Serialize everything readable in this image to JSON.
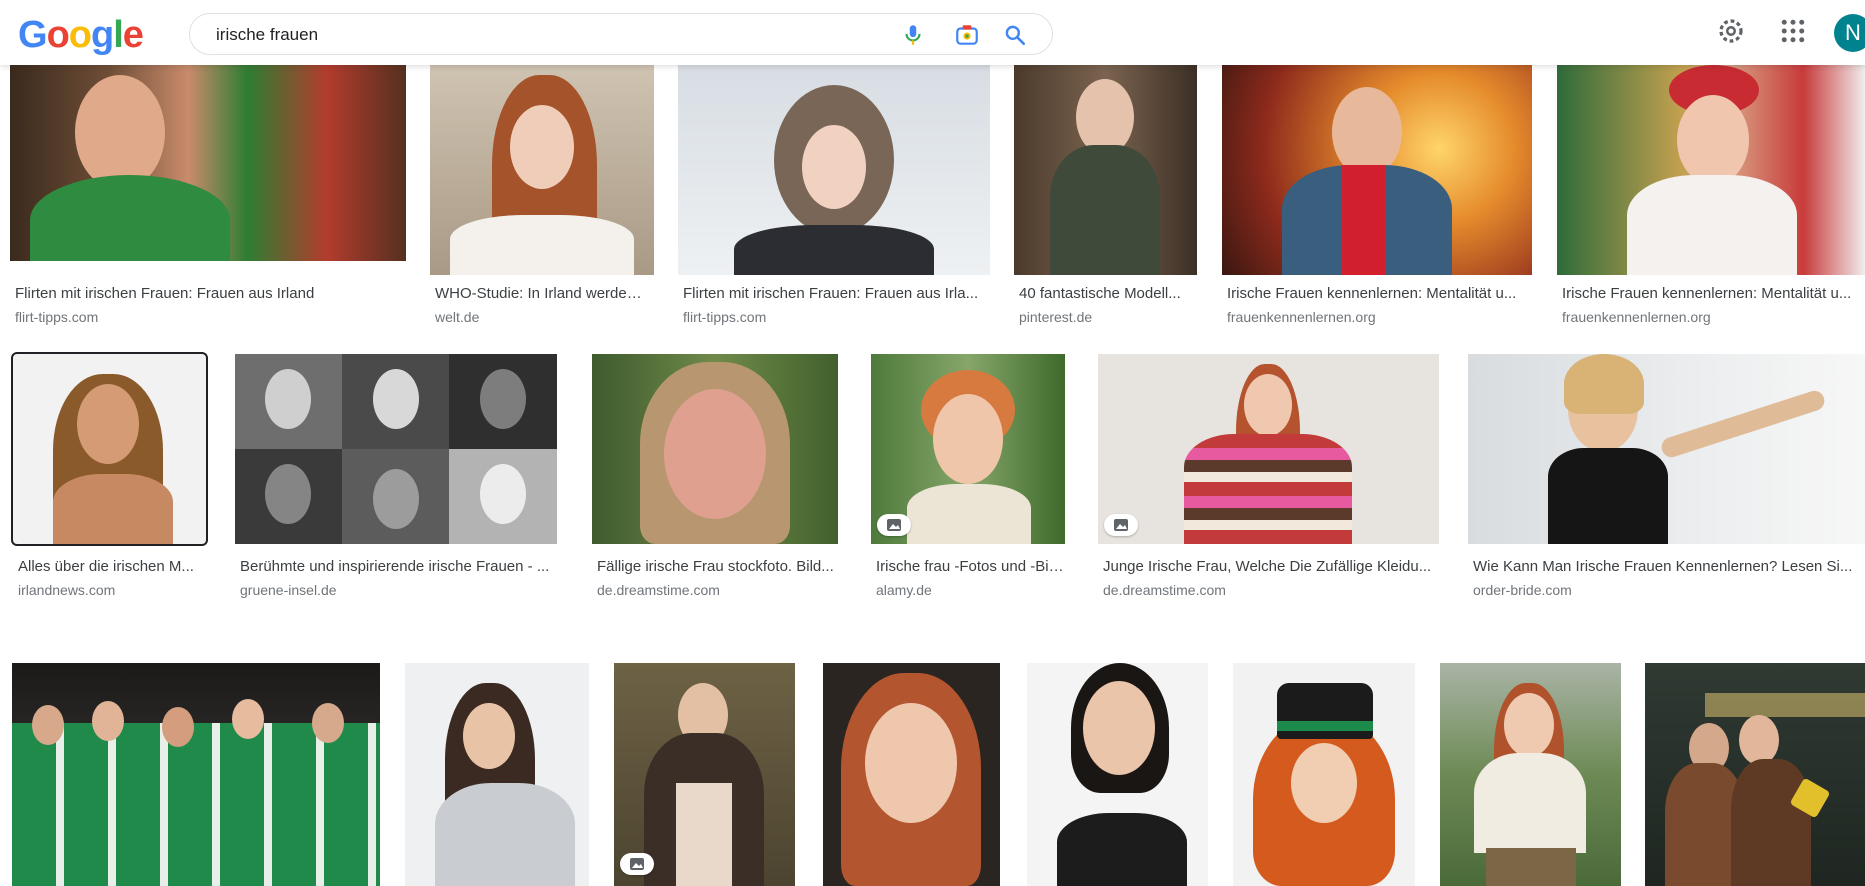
{
  "header": {
    "logo_letters": [
      "G",
      "o",
      "o",
      "g",
      "l",
      "e"
    ],
    "search_value": "irische frauen",
    "avatar_letter": "N"
  },
  "colors": {
    "brand_blue": "#4285f4",
    "brand_red": "#ea4335",
    "brand_yellow": "#fbbc05",
    "brand_green": "#34a853",
    "avatar_bg": "#00838f"
  },
  "results": {
    "row1": [
      {
        "title": "Flirten mit irischen Frauen: Frauen aus Irland",
        "source": "flirt-tipps.com"
      },
      {
        "title": "WHO-Studie: In Irland werden ...",
        "source": "welt.de"
      },
      {
        "title": "Flirten mit irischen Frauen: Frauen aus Irla...",
        "source": "flirt-tipps.com"
      },
      {
        "title": "40 fantastische Modell...",
        "source": "pinterest.de"
      },
      {
        "title": "Irische Frauen kennenlernen: Mentalität u...",
        "source": "frauenkennenlernen.org"
      },
      {
        "title": "Irische Frauen kennenlernen: Mentalität u...",
        "source": "frauenkennenlernen.org"
      }
    ],
    "row2": [
      {
        "title": "Alles über die irischen M...",
        "source": "irlandnews.com"
      },
      {
        "title": "Berühmte und inspirierende irische Frauen - ...",
        "source": "gruene-insel.de"
      },
      {
        "title": "Fällige irische Frau stockfoto. Bild...",
        "source": "de.dreamstime.com"
      },
      {
        "title": "Irische frau -Fotos und -Bil...",
        "source": "alamy.de"
      },
      {
        "title": "Junge Irische Frau, Welche Die Zufällige Kleidu...",
        "source": "de.dreamstime.com"
      },
      {
        "title": "Wie Kann Man Irische Frauen Kennenlernen? Lesen Si...",
        "source": "order-bride.com"
      }
    ],
    "row3_count_note": "8 thumbnails without visible captions"
  },
  "icons": {
    "mic": "microphone-icon",
    "lens": "camera-search-icon",
    "search": "search-icon",
    "settings": "gear-icon",
    "apps": "apps-grid-icon",
    "image_badge": "image-icon"
  }
}
